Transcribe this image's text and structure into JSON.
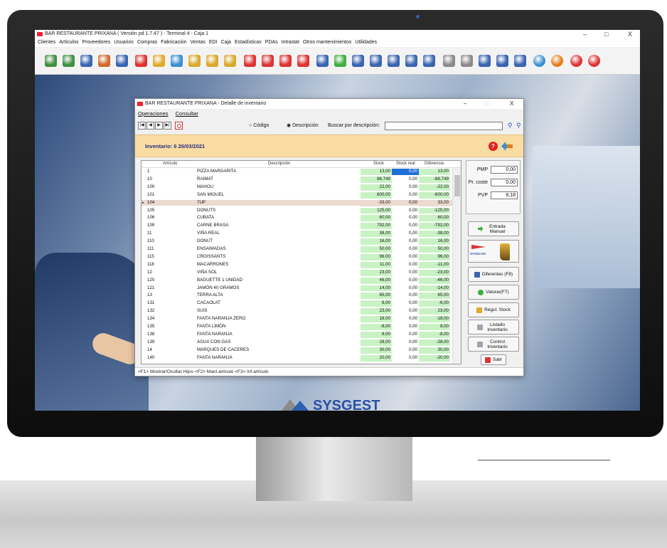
{
  "app": {
    "title": "BAR RESTAURANTE PRIXANA ( Versión pd 1.7.47 ) - Terminal 4 - Caja 1",
    "window_controls": [
      "–",
      "□",
      "X"
    ]
  },
  "menubar": [
    "Clientes",
    "Artículos",
    "Proveedores",
    "Usuarios",
    "Compras",
    "Fabricación",
    "Ventas",
    "EDI",
    "Caja",
    "Estadísticas",
    "PDAs",
    "Intrastat",
    "Otros mantenimientos",
    "Utilidades"
  ],
  "toolbar": {
    "icons": [
      {
        "name": "user-icon",
        "color": "#3f8f3f"
      },
      {
        "name": "user-icon",
        "color": "#3f8f3f"
      },
      {
        "name": "list-icon",
        "color": "#3a64b0"
      },
      {
        "name": "people-icon",
        "color": "#d06a2a"
      },
      {
        "name": "user-icon",
        "color": "#3a64b0"
      },
      {
        "name": "pin-icon",
        "color": "#d33"
      },
      {
        "name": "lock-icon",
        "color": "#e0a92a"
      },
      {
        "name": "card-icon",
        "color": "#3a8fd0"
      },
      {
        "name": "coins-icon",
        "color": "#d8a92a"
      },
      {
        "name": "coins-icon",
        "color": "#d8a92a"
      },
      {
        "name": "coins-icon",
        "color": "#d8a92a"
      },
      {
        "name": "cart-icon",
        "color": "#d33"
      },
      {
        "name": "truck-icon",
        "color": "#d33"
      },
      {
        "name": "doc-icon",
        "color": "#d33"
      },
      {
        "name": "doc-icon",
        "color": "#d33"
      },
      {
        "name": "grid-icon",
        "color": "#3a64b0"
      },
      {
        "name": "check-icon",
        "color": "#3fae3f"
      },
      {
        "name": "cart-icon",
        "color": "#3a64b0"
      },
      {
        "name": "cart-icon",
        "color": "#3a64b0"
      },
      {
        "name": "truck-icon",
        "color": "#3a64b0"
      },
      {
        "name": "doc-icon",
        "color": "#3a64b0"
      },
      {
        "name": "doc-icon",
        "color": "#3a64b0"
      },
      {
        "name": "tools-icon",
        "color": "#8a8a8a"
      },
      {
        "name": "tools-icon",
        "color": "#8a8a8a"
      },
      {
        "name": "truck-icon",
        "color": "#3a64b0"
      },
      {
        "name": "doc-icon",
        "color": "#3a64b0"
      },
      {
        "name": "doc-icon",
        "color": "#3a64b0"
      },
      {
        "name": "back-icon",
        "color": "#3a8fd0"
      },
      {
        "name": "forward-icon",
        "color": "#e57c1e"
      },
      {
        "name": "help-icon",
        "color": "#d33"
      },
      {
        "name": "power-icon",
        "color": "#d33"
      }
    ]
  },
  "dialog": {
    "title": "BAR RESTAURANTE PRIXANA - Detalle de inventario",
    "menu": [
      "Operaciones",
      "Consultar"
    ],
    "nav": [
      "|◀",
      "◀",
      "▶",
      "▶|"
    ],
    "radio_code": "Código",
    "radio_desc": "Descripción",
    "search_label": "Buscar por descripción:",
    "inventory_label": "Inventario: 6  26/03/2021",
    "columns": {
      "articulo": "Artículo",
      "descripcion": "Descripción",
      "stock": "Stock",
      "real": "Stock real",
      "diferencia": "Diferencia"
    },
    "rows": [
      {
        "art": "1",
        "desc": "PIZZA MARGARITA",
        "stock": "13,00",
        "real": "0,00",
        "dif": "13,00"
      },
      {
        "art": "10",
        "desc": "RAIMAT",
        "stock": "88,749",
        "real": "0,00",
        "dif": "-88,749"
      },
      {
        "art": "100",
        "desc": "MAHOU",
        "stock": "22,00",
        "real": "0,00",
        "dif": "-22,00"
      },
      {
        "art": "101",
        "desc": "SAN MIGUEL",
        "stock": "600,00",
        "real": "0,00",
        "dif": "-600,00"
      },
      {
        "art": "104",
        "desc": "7UP",
        "stock": "-33,00",
        "real": "0,00",
        "dif": "33,00",
        "sel": true
      },
      {
        "art": "105",
        "desc": "DONUTS",
        "stock": "125,00",
        "real": "0,00",
        "dif": "-125,00"
      },
      {
        "art": "106",
        "desc": "CUBATA",
        "stock": "60,00",
        "real": "0,00",
        "dif": "60,00"
      },
      {
        "art": "109",
        "desc": "CARNE BRASA",
        "stock": "792,00",
        "real": "0,00",
        "dif": "-792,00"
      },
      {
        "art": "11",
        "desc": "VIÑA REAL",
        "stock": "38,00",
        "real": "0,00",
        "dif": "-38,00"
      },
      {
        "art": "110",
        "desc": "DONUT",
        "stock": "16,00",
        "real": "0,00",
        "dif": "16,00"
      },
      {
        "art": "111",
        "desc": "ENSAIMADAS",
        "stock": "50,00",
        "real": "0,00",
        "dif": "50,00"
      },
      {
        "art": "115",
        "desc": "CROISSANTS",
        "stock": "96,00",
        "real": "0,00",
        "dif": "96,00"
      },
      {
        "art": "118",
        "desc": "MACARRONES",
        "stock": "11,00",
        "real": "0,00",
        "dif": "-11,00"
      },
      {
        "art": "12",
        "desc": "VIÑA SOL",
        "stock": "23,00",
        "real": "0,00",
        "dif": "-23,00"
      },
      {
        "art": "120",
        "desc": "BAGUETTE 1 UNIDAD",
        "stock": "46,00",
        "real": "0,00",
        "dif": "-46,00"
      },
      {
        "art": "121",
        "desc": "JAMÓN 40 GRAMOS",
        "stock": "14,00",
        "real": "0,00",
        "dif": "-14,00"
      },
      {
        "art": "13",
        "desc": "TERRA ALTA",
        "stock": "65,00",
        "real": "0,00",
        "dif": "65,00"
      },
      {
        "art": "131",
        "desc": "CACAOLAT",
        "stock": "6,00",
        "real": "0,00",
        "dif": "-6,00"
      },
      {
        "art": "132",
        "desc": "SUIS",
        "stock": "23,00",
        "real": "0,00",
        "dif": "23,00"
      },
      {
        "art": "134",
        "desc": "FANTA NARANJA ZERO",
        "stock": "18,00",
        "real": "0,00",
        "dif": "-18,00"
      },
      {
        "art": "135",
        "desc": "FANTA LIMÓN",
        "stock": "-8,00",
        "real": "0,00",
        "dif": "8,00"
      },
      {
        "art": "138",
        "desc": "FANTA NARANJA",
        "stock": "8,00",
        "real": "0,00",
        "dif": "-8,00"
      },
      {
        "art": "139",
        "desc": "AGUA CON GAS",
        "stock": "28,00",
        "real": "0,00",
        "dif": "-28,00"
      },
      {
        "art": "14",
        "desc": "MARQUES DE CACERES",
        "stock": "30,00",
        "real": "0,00",
        "dif": "30,00"
      },
      {
        "art": "140",
        "desc": "FANTA NARANJA",
        "stock": "20,00",
        "real": "0,00",
        "dif": "-20,00"
      }
    ],
    "prices": {
      "pmp_label": "PMP",
      "pmp": "0,00",
      "pcoste_label": "Pr. coste",
      "pcoste": "0,00",
      "pvp_label": "PVP",
      "pvp": "8,18"
    },
    "buttons": {
      "entrada": "Entrada Manual",
      "sysscan": "SYSSCAN",
      "diferentes": "Diferentes (F8)",
      "valorar": "Valorar(F7)",
      "regul": "Regul. Stock",
      "listado": "Listado Inventario",
      "control": "Control Inventario",
      "salir": "Salir"
    },
    "status": "<F1> Mostrar/Ocultar Hijos <F2> Mant.artículo <F3> Inf.artículo"
  },
  "logo": "SYSGEST"
}
